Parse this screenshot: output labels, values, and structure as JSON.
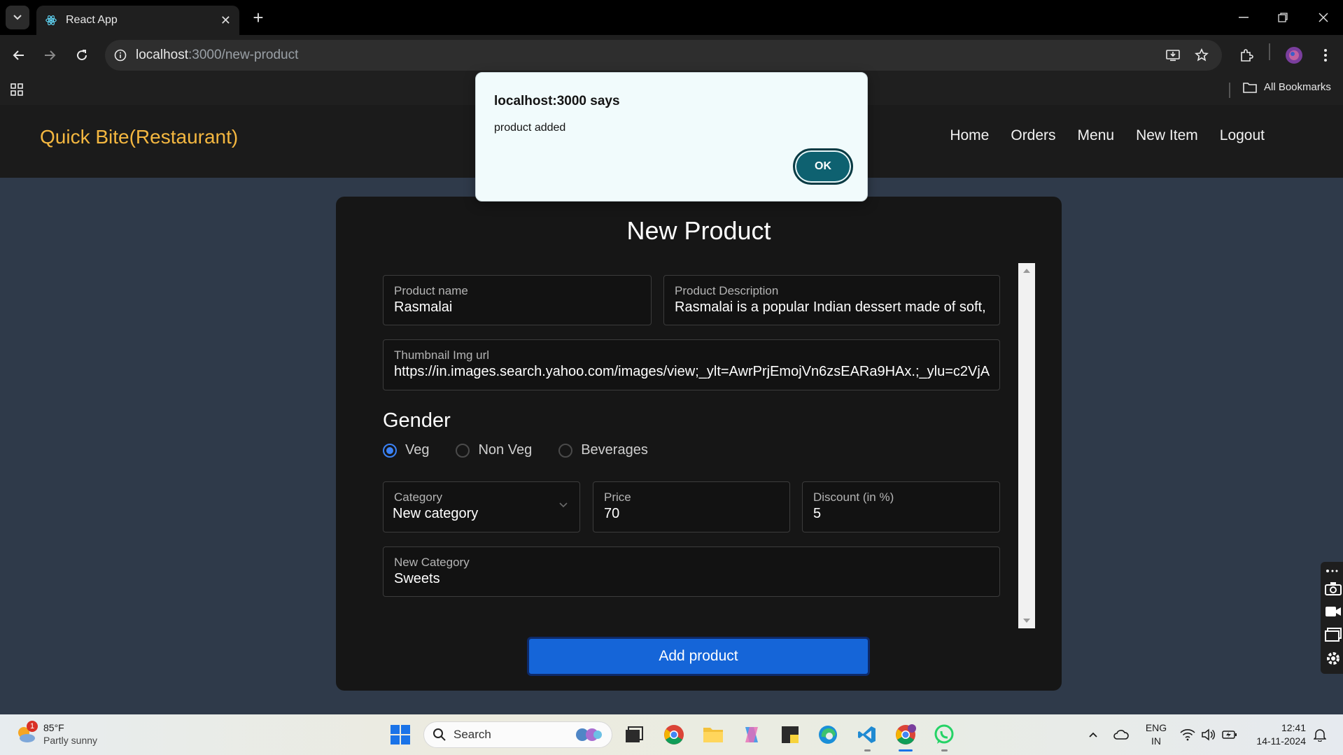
{
  "browser": {
    "tab_title": "React App",
    "url_host": "localhost",
    "url_path": ":3000/new-product",
    "bookmarks_label": "All Bookmarks"
  },
  "app": {
    "brand": "Quick Bite(Restaurant)",
    "nav": [
      "Home",
      "Orders",
      "Menu",
      "New Item",
      "Logout"
    ]
  },
  "form": {
    "title": "New Product",
    "product_name": {
      "label": "Product name",
      "value": "Rasmalai"
    },
    "product_description": {
      "label": "Product Description",
      "value": "Rasmalai is a popular Indian dessert made of soft,"
    },
    "thumbnail": {
      "label": "Thumbnail Img url",
      "value": "https://in.images.search.yahoo.com/images/view;_ylt=AwrPrjEmojVn6zsEARa9HAx.;_ylu=c2VjA"
    },
    "gender_title": "Gender",
    "gender_options": [
      {
        "label": "Veg",
        "selected": true
      },
      {
        "label": "Non Veg",
        "selected": false
      },
      {
        "label": "Beverages",
        "selected": false
      }
    ],
    "category": {
      "label": "Category",
      "value": "New category"
    },
    "price": {
      "label": "Price",
      "value": "70"
    },
    "discount": {
      "label": "Discount (in %)",
      "value": "5"
    },
    "new_category": {
      "label": "New Category",
      "value": "Sweets"
    },
    "submit_label": "Add product"
  },
  "dialog": {
    "title": "localhost:3000 says",
    "message": "product added",
    "ok_label": "OK"
  },
  "taskbar": {
    "weather_temp": "85°F",
    "weather_desc": "Partly sunny",
    "weather_badge": "1",
    "search_label": "Search",
    "lang_top": "ENG",
    "lang_bottom": "IN",
    "time": "12:41",
    "date": "14-11-2024"
  },
  "colors": {
    "brand": "#f4b740",
    "primary_button": "#1565d8",
    "radio_selected": "#3b82f6",
    "dialog_ok": "#0e6170"
  }
}
